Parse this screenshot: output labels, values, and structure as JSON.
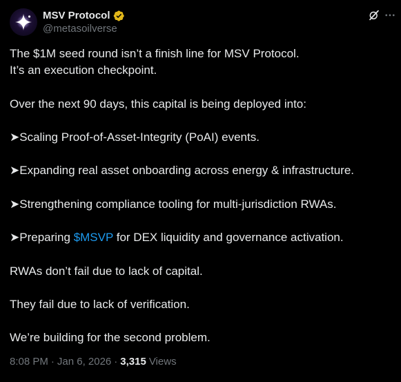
{
  "author": {
    "display_name": "MSV Protocol",
    "handle": "@metasoilverse"
  },
  "icons": {
    "verified": "verified-badge-icon",
    "grok": "grok-icon",
    "more": "more-options-icon"
  },
  "colors": {
    "background": "#000000",
    "text": "#e7e9ea",
    "muted": "#71767b",
    "link": "#1d9bf0",
    "verified_badge": "#e2b719"
  },
  "tweet": {
    "p1_l1": "The $1M seed round isn’t a finish line for MSV Protocol.",
    "p1_l2": "It’s an execution checkpoint.",
    "p2": "Over the next 90 days, this capital is being deployed into:",
    "b1": "➤Scaling Proof-of-Asset-Integrity (PoAI) events.",
    "b2": "➤Expanding real asset onboarding across energy & infrastructure.",
    "b3": "➤Strengthening compliance tooling for multi-jurisdiction RWAs.",
    "b4_prefix": "➤Preparing ",
    "b4_cashtag": "$MSVP",
    "b4_suffix": " for DEX liquidity and governance activation.",
    "p3": "RWAs don’t fail due to lack of capital.",
    "p4": "They fail due to lack of verification.",
    "p5": "We’re building for the second problem."
  },
  "meta": {
    "time": "8:08 PM",
    "dot1": "·",
    "date": "Jan 6, 2026",
    "dot2": "·",
    "views_count": "3,315",
    "views_label": "Views"
  }
}
